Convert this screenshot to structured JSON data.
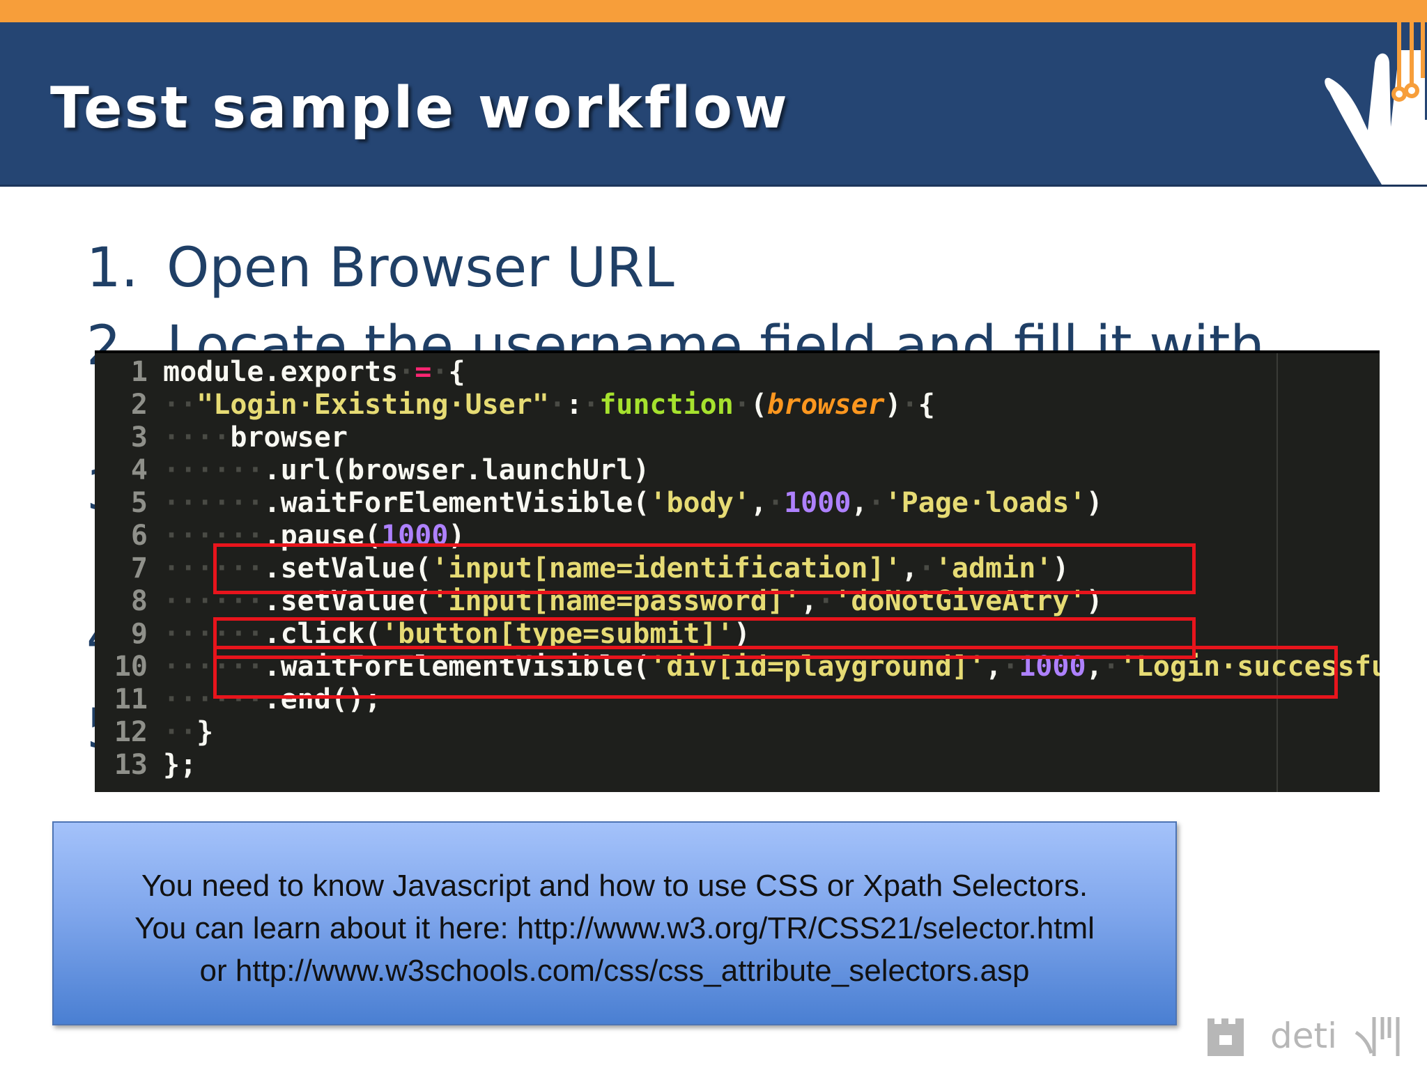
{
  "slide": {
    "title": "Test sample workflow",
    "steps": [
      {
        "num": "1.",
        "text": "Open Browser URL"
      },
      {
        "num": "2.",
        "text": "Locate the username field and fill it with"
      }
    ],
    "hidden_step_numbers": [
      "3",
      "4",
      "5"
    ]
  },
  "code": {
    "lines": [
      {
        "n": "1",
        "tokens": [
          {
            "c": "w",
            "t": "module.exports"
          },
          {
            "c": "s",
            "t": "·"
          },
          {
            "c": "r",
            "t": "="
          },
          {
            "c": "s",
            "t": "·"
          },
          {
            "c": "w",
            "t": "{"
          }
        ]
      },
      {
        "n": "2",
        "tokens": [
          {
            "c": "s",
            "t": "··"
          },
          {
            "c": "y",
            "t": "\"Login·Existing·User\""
          },
          {
            "c": "s",
            "t": "·"
          },
          {
            "c": "w",
            "t": ":"
          },
          {
            "c": "s",
            "t": "·"
          },
          {
            "c": "g",
            "t": "function"
          },
          {
            "c": "s",
            "t": "·"
          },
          {
            "c": "w",
            "t": "("
          },
          {
            "c": "o",
            "t": "browser"
          },
          {
            "c": "w",
            "t": ")"
          },
          {
            "c": "s",
            "t": "·"
          },
          {
            "c": "w",
            "t": "{"
          }
        ]
      },
      {
        "n": "3",
        "tokens": [
          {
            "c": "s",
            "t": "····"
          },
          {
            "c": "w",
            "t": "browser"
          }
        ]
      },
      {
        "n": "4",
        "tokens": [
          {
            "c": "s",
            "t": "······"
          },
          {
            "c": "w",
            "t": ".url(browser.launchUrl)"
          }
        ]
      },
      {
        "n": "5",
        "tokens": [
          {
            "c": "s",
            "t": "······"
          },
          {
            "c": "w",
            "t": ".waitForElementVisible("
          },
          {
            "c": "y",
            "t": "'body'"
          },
          {
            "c": "w",
            "t": ","
          },
          {
            "c": "s",
            "t": "·"
          },
          {
            "c": "p",
            "t": "1000"
          },
          {
            "c": "w",
            "t": ","
          },
          {
            "c": "s",
            "t": "·"
          },
          {
            "c": "y",
            "t": "'Page·loads'"
          },
          {
            "c": "w",
            "t": ")"
          }
        ]
      },
      {
        "n": "6",
        "tokens": [
          {
            "c": "s",
            "t": "······"
          },
          {
            "c": "w",
            "t": ".pause("
          },
          {
            "c": "p",
            "t": "1000"
          },
          {
            "c": "w",
            "t": ")"
          }
        ]
      },
      {
        "n": "7",
        "tokens": [
          {
            "c": "s",
            "t": "······"
          },
          {
            "c": "w",
            "t": ".setValue("
          },
          {
            "c": "y",
            "t": "'input[name=identification]'"
          },
          {
            "c": "w",
            "t": ","
          },
          {
            "c": "s",
            "t": "·"
          },
          {
            "c": "y",
            "t": "'admin'"
          },
          {
            "c": "w",
            "t": ")"
          }
        ]
      },
      {
        "n": "8",
        "tokens": [
          {
            "c": "s",
            "t": "······"
          },
          {
            "c": "w",
            "t": ".setValue("
          },
          {
            "c": "y",
            "t": "'input[name=password]'"
          },
          {
            "c": "w",
            "t": ","
          },
          {
            "c": "s",
            "t": "·"
          },
          {
            "c": "y",
            "t": "'doNotGiveAtry'"
          },
          {
            "c": "w",
            "t": ")"
          }
        ]
      },
      {
        "n": "9",
        "tokens": [
          {
            "c": "s",
            "t": "······"
          },
          {
            "c": "w",
            "t": ".click("
          },
          {
            "c": "y",
            "t": "'button[type=submit]'"
          },
          {
            "c": "w",
            "t": ")"
          }
        ]
      },
      {
        "n": "10",
        "tokens": [
          {
            "c": "s",
            "t": "······"
          },
          {
            "c": "w",
            "t": ".waitForElementVisible("
          },
          {
            "c": "y",
            "t": "'div[id=playground]'"
          },
          {
            "c": "w",
            "t": ","
          },
          {
            "c": "s",
            "t": "·"
          },
          {
            "c": "p",
            "t": "1000"
          },
          {
            "c": "w",
            "t": ","
          },
          {
            "c": "s",
            "t": "·"
          },
          {
            "c": "y",
            "t": "'Login·successful'"
          },
          {
            "c": "w",
            "t": ")"
          }
        ]
      },
      {
        "n": "11",
        "tokens": [
          {
            "c": "s",
            "t": "······"
          },
          {
            "c": "w",
            "t": ".end();"
          }
        ]
      },
      {
        "n": "12",
        "tokens": [
          {
            "c": "s",
            "t": "··"
          },
          {
            "c": "w",
            "t": "}"
          }
        ]
      },
      {
        "n": "13",
        "tokens": [
          {
            "c": "w",
            "t": "};"
          }
        ]
      }
    ],
    "highlighted_lines": [
      7,
      9,
      10
    ]
  },
  "note": {
    "lines": [
      "You need to know Javascript and how to use CSS or Xpath Selectors.",
      "You can learn about it here: http://www.w3.org/TR/CSS21/selector.html",
      "or http://www.w3schools.com/css/css_attribute_selectors.asp"
    ]
  },
  "footer": {
    "logo_text": "deti"
  },
  "colors": {
    "accent_orange": "#f79e3a",
    "header_blue": "#254573",
    "highlight_red": "#e8141c"
  }
}
